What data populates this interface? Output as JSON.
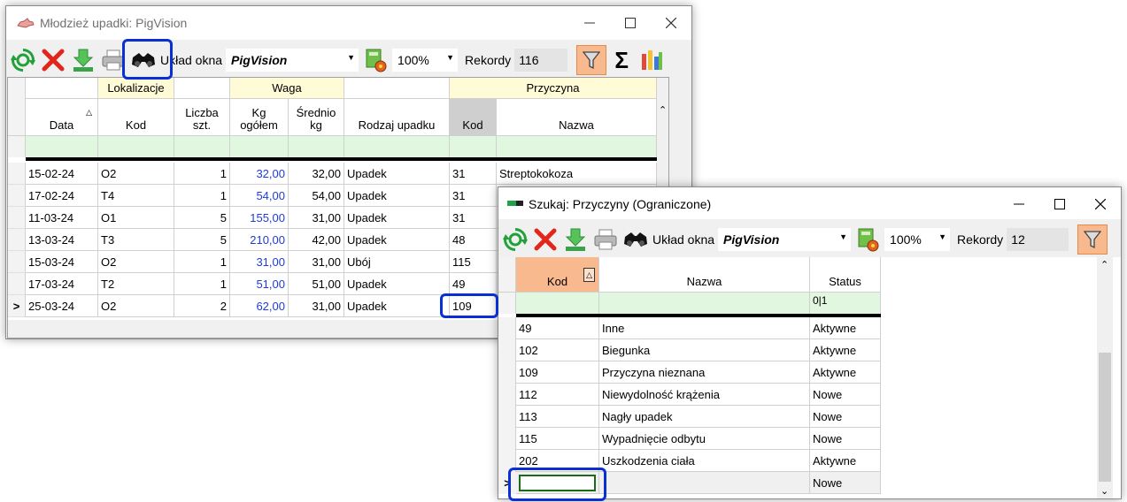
{
  "win1": {
    "title": "Młodzież upadki: PigVision",
    "toolbar": {
      "layout_label": "Układ okna",
      "layout_value": "PigVision",
      "zoom_value": "100%",
      "records_label": "Rekordy",
      "records_value": "116"
    },
    "groups": {
      "lokalizacja": "Lokalizacje",
      "waga": "Waga",
      "przyczyna": "Przyczyna"
    },
    "columns": {
      "data": "Data",
      "kod": "Kod",
      "liczba": "Liczba szt.",
      "kg": "Kg ogółem",
      "srednio": "Średnio kg",
      "rodzaj": "Rodzaj upadku",
      "p_kod": "Kod",
      "p_nazwa": "Nazwa"
    },
    "rows": [
      {
        "data": "15-02-24",
        "kod": "O2",
        "liczba": "1",
        "kg": "32,00",
        "srednio": "32,00",
        "rodzaj": "Upadek",
        "p_kod": "31",
        "p_nazwa": "Streptokokoza"
      },
      {
        "data": "17-02-24",
        "kod": "T4",
        "liczba": "1",
        "kg": "54,00",
        "srednio": "54,00",
        "rodzaj": "Upadek",
        "p_kod": "31",
        "p_nazwa": ""
      },
      {
        "data": "11-03-24",
        "kod": "O1",
        "liczba": "5",
        "kg": "155,00",
        "srednio": "31,00",
        "rodzaj": "Upadek",
        "p_kod": "31",
        "p_nazwa": ""
      },
      {
        "data": "13-03-24",
        "kod": "T3",
        "liczba": "5",
        "kg": "210,00",
        "srednio": "42,00",
        "rodzaj": "Upadek",
        "p_kod": "48",
        "p_nazwa": ""
      },
      {
        "data": "15-03-24",
        "kod": "O2",
        "liczba": "1",
        "kg": "31,00",
        "srednio": "31,00",
        "rodzaj": "Ubój",
        "p_kod": "115",
        "p_nazwa": ""
      },
      {
        "data": "17-03-24",
        "kod": "T2",
        "liczba": "1",
        "kg": "51,00",
        "srednio": "51,00",
        "rodzaj": "Upadek",
        "p_kod": "49",
        "p_nazwa": ""
      },
      {
        "data": "25-03-24",
        "kod": "O2",
        "liczba": "2",
        "kg": "62,00",
        "srednio": "31,00",
        "rodzaj": "Upadek",
        "p_kod": "109",
        "p_nazwa": ""
      }
    ],
    "current_row_marker": ">"
  },
  "win2": {
    "title": "Szukaj: Przyczyny (Ograniczone)",
    "toolbar": {
      "layout_label": "Układ okna",
      "layout_value": "PigVision",
      "zoom_value": "100%",
      "records_label": "Rekordy",
      "records_value": "12"
    },
    "columns": {
      "kod": "Kod",
      "nazwa": "Nazwa",
      "status": "Status"
    },
    "status_filter": "0|1",
    "rows": [
      {
        "kod": "49",
        "nazwa": "Inne",
        "status": "Aktywne"
      },
      {
        "kod": "102",
        "nazwa": "Biegunka",
        "status": "Aktywne"
      },
      {
        "kod": "109",
        "nazwa": "Przyczyna nieznana",
        "status": "Aktywne"
      },
      {
        "kod": "112",
        "nazwa": "Niewydolność krążenia",
        "status": "Nowe"
      },
      {
        "kod": "113",
        "nazwa": "Nagły upadek",
        "status": "Nowe"
      },
      {
        "kod": "115",
        "nazwa": "Wypadnięcie odbytu",
        "status": "Nowe"
      },
      {
        "kod": "202",
        "nazwa": "Uszkodzenia ciała",
        "status": "Aktywne"
      }
    ],
    "new_row_status": "Nowe",
    "current_row_marker": ">"
  },
  "colors": {
    "highlight_blue": "#0a2fd6",
    "filter_row_green": "#e2f7e0",
    "group_header_yellow": "#fffbd6",
    "sort_header_orange": "#f7b98d",
    "value_blue": "#1f3cd6"
  }
}
